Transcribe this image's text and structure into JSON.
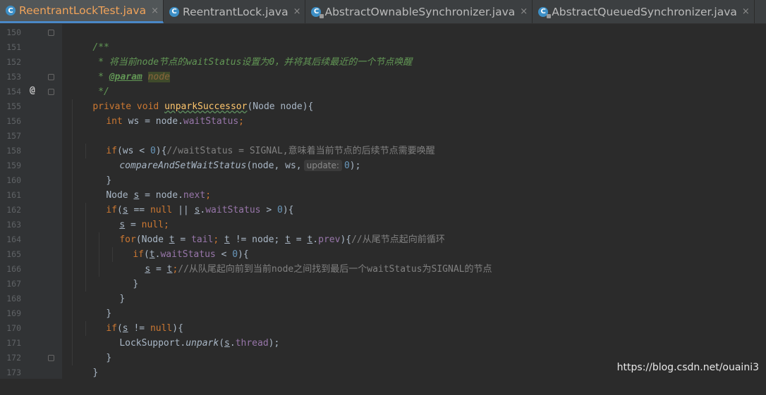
{
  "tabs": [
    {
      "label": "ReentrantLockTest.java",
      "icon": "class-icon",
      "active": true
    },
    {
      "label": "ReentrantLock.java",
      "icon": "class-icon",
      "active": false
    },
    {
      "label": "AbstractOwnableSynchronizer.java",
      "icon": "locked-class-icon",
      "active": false
    },
    {
      "label": "AbstractQueuedSynchronizer.java",
      "icon": "locked-class-icon",
      "active": false
    }
  ],
  "close_glyph": "×",
  "lines": {
    "l150": {
      "n": "150",
      "a": "/**"
    },
    "l151": {
      "n": "151",
      "a": " * 将当前",
      "b": "node",
      "c": "节点的",
      "d": "waitStatus",
      "e": "设置为0，并将其后续最近的一个节点唤醒"
    },
    "l152": {
      "n": "152",
      "a": " * ",
      "b": "@param",
      "c": " ",
      "d": "node"
    },
    "l153": {
      "n": "153",
      "a": " */"
    },
    "l154": {
      "n": "154",
      "at": "@",
      "a": "private void ",
      "b": "unparkSuccessor",
      "c": "(Node node){"
    },
    "l155": {
      "n": "155",
      "a": "int",
      "b": " ws = node.",
      "c": "waitStatus",
      "d": ";"
    },
    "l156": {
      "n": "156"
    },
    "l157": {
      "n": "157",
      "a": "if",
      "b": "(ws < ",
      "c": "0",
      "d": "){",
      "e": "//waitStatus = SIGNAL,意味着当前节点的后续节点需要唤醒"
    },
    "l158": {
      "n": "158",
      "a": "compareAndSetWaitStatus",
      "b": "(node, ws,",
      "hint": "update:",
      "c": "0",
      "d": ");"
    },
    "l159": {
      "n": "159",
      "a": "}"
    },
    "l160": {
      "n": "160",
      "a": "Node ",
      "b": "s",
      "c": " = node.",
      "d": "next",
      "e": ";"
    },
    "l161": {
      "n": "161",
      "a": "if",
      "b": "(",
      "c": "s",
      "d": " == ",
      "e": "null",
      "f": " || ",
      "g": "s",
      "h": ".",
      "i": "waitStatus",
      "j": " > ",
      "k": "0",
      "l": "){"
    },
    "l162": {
      "n": "162",
      "a": "s",
      "b": " = ",
      "c": "null",
      "d": ";"
    },
    "l163": {
      "n": "163",
      "a": "for",
      "b": "(Node ",
      "c": "t",
      "d": " = ",
      "e": "tail",
      "f": "; ",
      "g": "t",
      "h": " != node; ",
      "i": "t",
      "j": " = ",
      "k": "t",
      "l": ".",
      "m": "prev",
      "n2": "){",
      "o": "//从尾节点起向前循环"
    },
    "l164": {
      "n": "164",
      "a": "if",
      "b": "(",
      "c": "t",
      "d": ".",
      "e": "waitStatus",
      "f": " < ",
      "g": "0",
      "h": "){"
    },
    "l165": {
      "n": "165",
      "a": "s",
      "b": " = ",
      "c": "t",
      "d": ";",
      "e": "//从队尾起向前到当前node之间找到最后一个waitStatus为SIGNAL的节点"
    },
    "l166": {
      "n": "166",
      "a": "}"
    },
    "l167": {
      "n": "167",
      "a": "}"
    },
    "l168": {
      "n": "168",
      "a": "}"
    },
    "l169": {
      "n": "169",
      "a": "if",
      "b": "(",
      "c": "s",
      "d": " != ",
      "e": "null",
      "f": "){"
    },
    "l170": {
      "n": "170",
      "a": "LockSupport.",
      "b": "unpark",
      "c": "(",
      "d": "s",
      "e": ".",
      "f": "thread",
      "g": ");"
    },
    "l171": {
      "n": "171",
      "a": "}"
    },
    "l172": {
      "n": "172",
      "a": "}"
    },
    "l173": {
      "n": "173"
    }
  },
  "watermark": "https://blog.csdn.net/ouaini3",
  "colors": {
    "background": "#2b2b2b",
    "keyword": "#cc7832",
    "field": "#9876aa",
    "number": "#6897bb",
    "doc_comment": "#629755",
    "method": "#ffc66d"
  }
}
